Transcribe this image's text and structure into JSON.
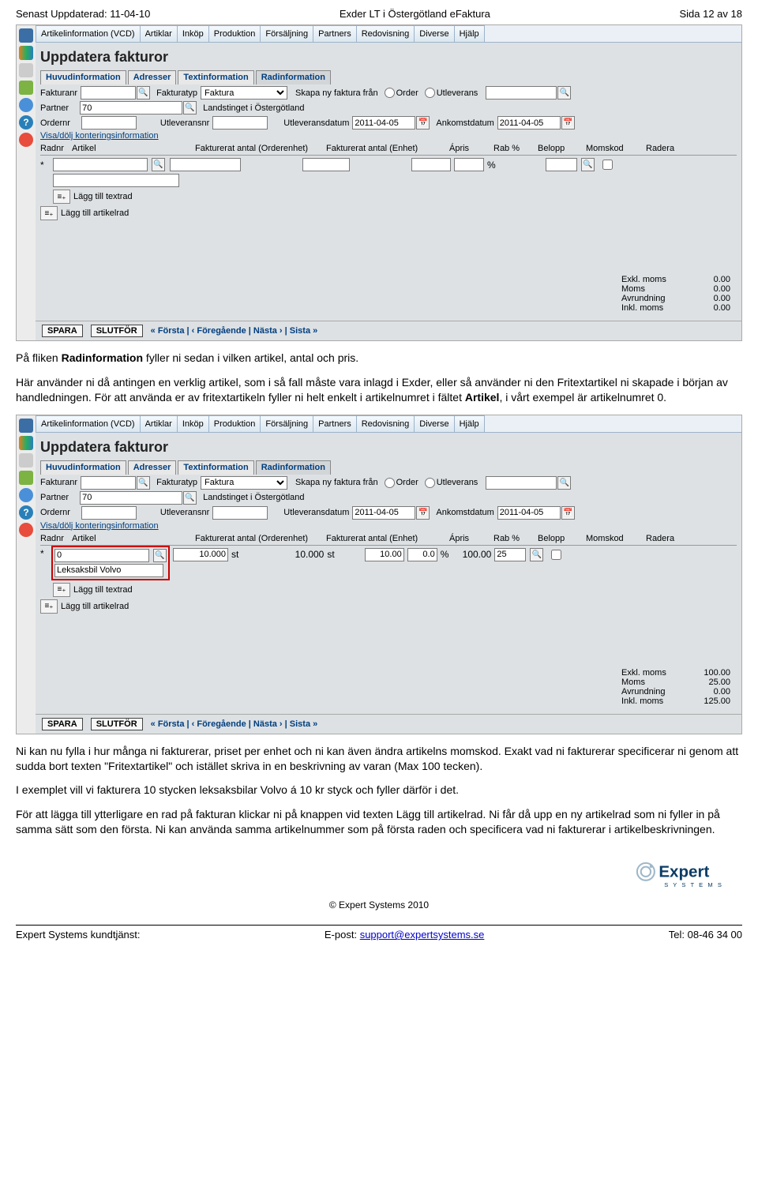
{
  "doc_header": {
    "left": "Senast Uppdaterad: 11-04-10",
    "center": "Exder LT i Östergötland eFaktura",
    "right": "Sida 12 av 18"
  },
  "menu": [
    "Artikelinformation (VCD)",
    "Artiklar",
    "Inköp",
    "Produktion",
    "Försäljning",
    "Partners",
    "Redovisning",
    "Diverse",
    "Hjälp"
  ],
  "page_title": "Uppdatera fakturor",
  "subtabs": [
    "Huvudinformation",
    "Adresser",
    "Textinformation",
    "Radinformation"
  ],
  "active_subtab": 3,
  "labels": {
    "fakturanr": "Fakturanr",
    "fakturatyp": "Fakturatyp",
    "fakturatyp_value": "Faktura",
    "skapa_ny": "Skapa ny faktura från",
    "order": "Order",
    "utleverans": "Utleverans",
    "partner": "Partner",
    "partner_value": "70",
    "partner_name": "Landstinget i Östergötland",
    "ordernr": "Ordernr",
    "utleveransnr": "Utleveransnr",
    "utleveransdatum": "Utleveransdatum",
    "utleveransdatum_value": "2011-04-05",
    "ankomstdatum": "Ankomstdatum",
    "ankomstdatum_value": "2011-04-05",
    "visa_dolj": "Visa/dölj konteringsinformation",
    "lagg_textrad": "Lägg till textrad",
    "lagg_artikelrad": "Lägg till artikelrad",
    "pct": "%"
  },
  "grid_headers": [
    "Radnr",
    "Artikel",
    "Fakturerat antal (Orderenhet)",
    "Fakturerat antal (Enhet)",
    "Ápris",
    "Rab %",
    "Belopp",
    "Momskod",
    "Radera"
  ],
  "shot1": {
    "radnr": "*",
    "totals": {
      "exkl": "0.00",
      "moms": "0.00",
      "avrundning": "0.00",
      "inkl": "0.00"
    }
  },
  "shot2": {
    "radnr": "*",
    "artikel_value": "0",
    "artikel_desc": "Leksaksbil Volvo",
    "antal_order": "10.000",
    "unit1": "st",
    "antal_enhet": "10.000",
    "unit2": "st",
    "apris": "10.00",
    "rab": "0.0",
    "belopp": "100.00",
    "momskod": "25",
    "totals": {
      "exkl": "100.00",
      "moms": "25.00",
      "avrundning": "0.00",
      "inkl": "125.00"
    }
  },
  "totals_labels": {
    "exkl": "Exkl. moms",
    "moms": "Moms",
    "avrundning": "Avrundning",
    "inkl": "Inkl. moms"
  },
  "footbar": {
    "spara": "SPARA",
    "slutfor": "SLUTFÖR",
    "pager": "« Första | ‹ Föregående | Nästa › | Sista »"
  },
  "paragraphs": {
    "p1a": "På fliken ",
    "p1b": "Radinformation",
    "p1c": " fyller ni sedan i vilken artikel, antal och pris.",
    "p2a": "Här använder ni då antingen en verklig artikel, som i så fall måste vara inlagd i Exder, eller så använder ni den Fritextartikel ni skapade i början av handledningen. För att använda er av fritextartikeln fyller ni helt enkelt i artikelnumret i fältet ",
    "p2b": "Artikel",
    "p2c": ", i vårt exempel är artikelnumret 0.",
    "p3": "Ni kan nu fylla i hur många ni fakturerar, priset per enhet och ni kan även ändra artikelns momskod. Exakt vad ni fakturerar specificerar ni genom att sudda bort texten \"Fritextartikel\" och istället skriva in en beskrivning av varan (Max 100 tecken).",
    "p4": "I exemplet vill vi fakturera 10 stycken leksaksbilar Volvo á 10 kr styck och fyller därför i det.",
    "p5": "För att lägga till ytterligare en rad på fakturan klickar ni på knappen vid texten Lägg till artikelrad. Ni får då upp en ny artikelrad som ni fyller in på samma sätt som den första. Ni kan använda samma artikelnummer som på första raden och specificera vad ni fakturerar i artikelbeskrivningen."
  },
  "footer": {
    "copyright": "© Expert Systems 2010",
    "left": "Expert Systems kundtjänst:",
    "mid_label": "E-post: ",
    "mid_link": "support@expertsystems.se",
    "right": "Tel: 08-46 34 00",
    "logo_main": "Expert",
    "logo_sub": "S Y S T E M S"
  }
}
